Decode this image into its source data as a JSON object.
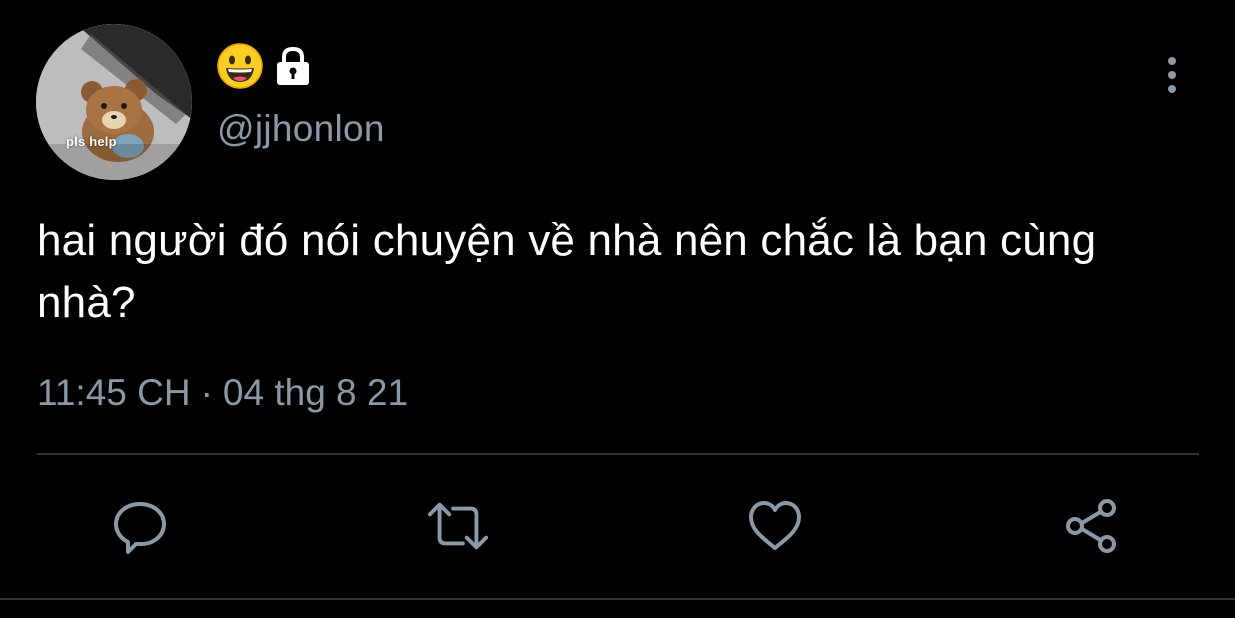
{
  "profile": {
    "avatar_caption": "pls help",
    "display_name_icons": [
      "grinning-face-emoji",
      "lock-icon"
    ],
    "handle": "@jjhonlon"
  },
  "tweet": {
    "text": "hai người đó nói chuyện về nhà nên chắc là bạn cùng nhà?",
    "time": "11:45 CH",
    "separator": "·",
    "date": "04 thg 8 21"
  },
  "actions": [
    {
      "name": "reply",
      "icon": "comment-bubble-icon"
    },
    {
      "name": "retweet",
      "icon": "retweet-arrows-icon"
    },
    {
      "name": "like",
      "icon": "heart-icon"
    },
    {
      "name": "share",
      "icon": "share-nodes-icon"
    }
  ],
  "colors": {
    "background": "#000000",
    "primary_text": "#ffffff",
    "secondary_text": "#8b98a5",
    "divider": "#2f3336",
    "icon": "#8b98a5"
  }
}
